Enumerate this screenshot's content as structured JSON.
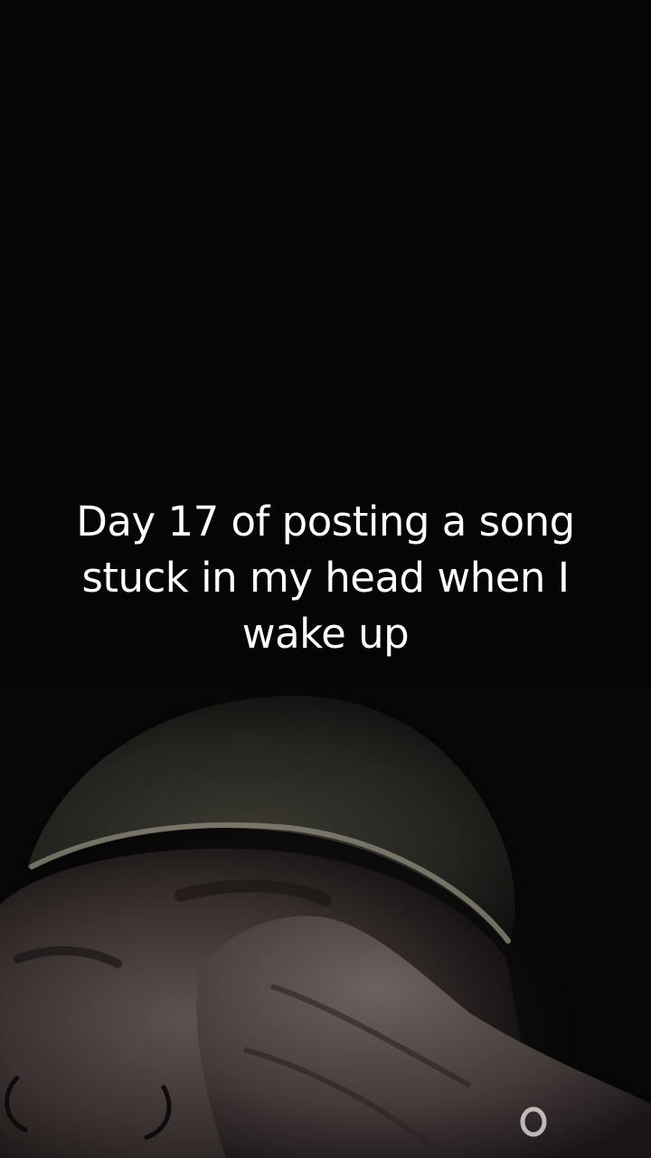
{
  "caption": {
    "lines": [
      "Day 17 of posting a song",
      "stuck in my head when I",
      "wake up"
    ]
  },
  "scene": {
    "subject": "person-face-with-beanie",
    "background_color": "#050505",
    "caption_color": "#ffffff"
  }
}
